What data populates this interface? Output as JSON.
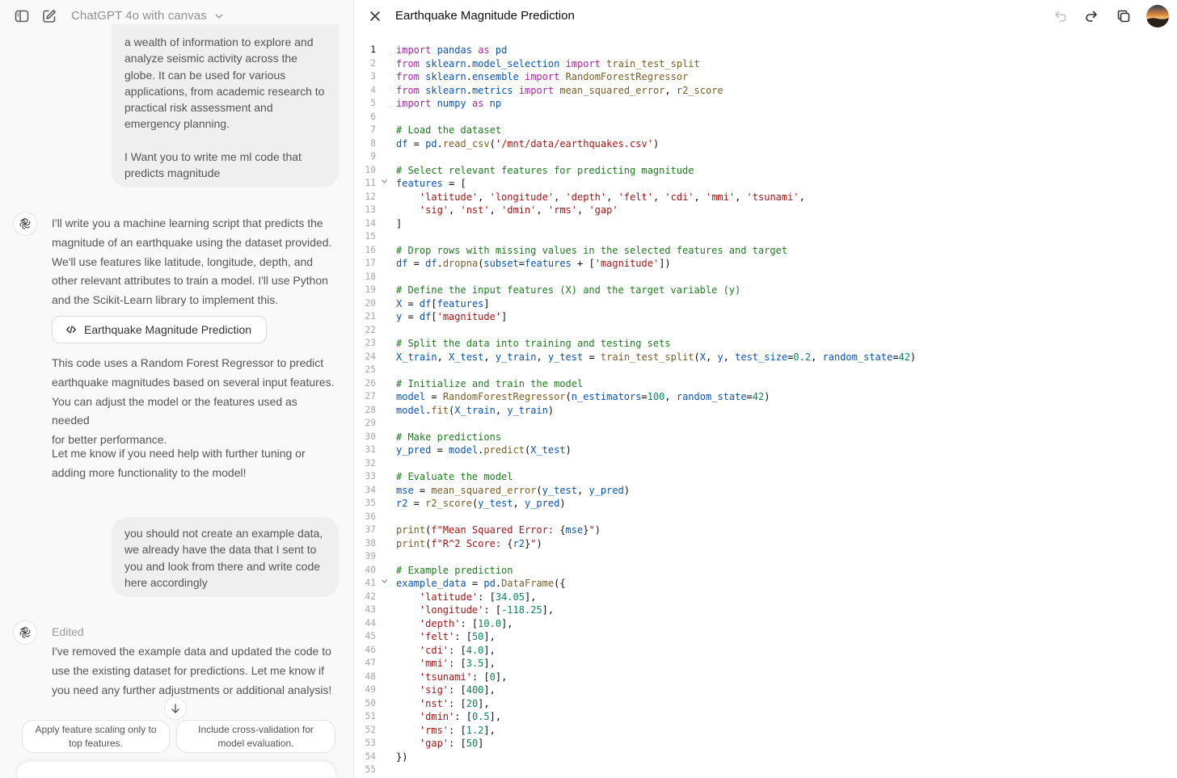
{
  "chat": {
    "model_name": "ChatGPT 4o with canvas",
    "user_message_1": {
      "lines": [
        "a wealth of information to explore and",
        "analyze seismic activity across the",
        "globe. It can be used for various",
        "applications, from academic research to",
        "practical risk assessment and",
        "emergency planning.",
        "",
        "I Want you to write me ml code that",
        "predicts magnitude"
      ]
    },
    "assistant_message_1": {
      "intro_lines": [
        "I'll write you a machine learning script that predicts the",
        "magnitude of an earthquake using the dataset provided.",
        "We'll use features like latitude, longitude, depth, and",
        "other relevant attributes to train a model. I'll use Python",
        "and the Scikit-Learn library to implement this."
      ],
      "canvas_chip_label": "Earthquake Magnitude Prediction",
      "body_lines": [
        "This code uses a Random Forest Regressor to predict",
        "earthquake magnitudes based on several input features.",
        "You can adjust the model or the features used as needed",
        "for better performance."
      ],
      "closing_lines": [
        "Let me know if you need help with further tuning or",
        "adding more functionality to the model!"
      ]
    },
    "user_message_2": {
      "lines": [
        "you should not create an example data,",
        "we already have the data that I sent to",
        "you and look from there and write code",
        "here accordingly"
      ]
    },
    "assistant_message_2": {
      "status": "Edited",
      "lines": [
        "I've removed the example data and updated the code to",
        "use the existing dataset for predictions. Let me know if",
        "you need any further adjustments or additional analysis!"
      ]
    },
    "suggestions": [
      {
        "line1": "Apply feature scaling only to",
        "line2": "top features."
      },
      {
        "line1": "Include cross-validation for",
        "line2": "model evaluation."
      }
    ]
  },
  "canvas": {
    "title": "Earthquake Magnitude Prediction",
    "active_line": 1,
    "fold_lines": [
      11,
      41
    ],
    "code_lines": [
      "import pandas as pd",
      "from sklearn.model_selection import train_test_split",
      "from sklearn.ensemble import RandomForestRegressor",
      "from sklearn.metrics import mean_squared_error, r2_score",
      "import numpy as np",
      "",
      "# Load the dataset",
      "df = pd.read_csv('/mnt/data/earthquakes.csv')",
      "",
      "# Select relevant features for predicting magnitude",
      "features = [",
      "    'latitude', 'longitude', 'depth', 'felt', 'cdi', 'mmi', 'tsunami',",
      "    'sig', 'nst', 'dmin', 'rms', 'gap'",
      "]",
      "",
      "# Drop rows with missing values in the selected features and target",
      "df = df.dropna(subset=features + ['magnitude'])",
      "",
      "# Define the input features (X) and the target variable (y)",
      "X = df[features]",
      "y = df['magnitude']",
      "",
      "# Split the data into training and testing sets",
      "X_train, X_test, y_train, y_test = train_test_split(X, y, test_size=0.2, random_state=42)",
      "",
      "# Initialize and train the model",
      "model = RandomForestRegressor(n_estimators=100, random_state=42)",
      "model.fit(X_train, y_train)",
      "",
      "# Make predictions",
      "y_pred = model.predict(X_test)",
      "",
      "# Evaluate the model",
      "mse = mean_squared_error(y_test, y_pred)",
      "r2 = r2_score(y_test, y_pred)",
      "",
      "print(f\"Mean Squared Error: {mse}\")",
      "print(f\"R^2 Score: {r2}\")",
      "",
      "# Example prediction",
      "example_data = pd.DataFrame({",
      "    'latitude': [34.05],",
      "    'longitude': [-118.25],",
      "    'depth': [10.0],",
      "    'felt': [50],",
      "    'cdi': [4.0],",
      "    'mmi': [3.5],",
      "    'tsunami': [0],",
      "    'sig': [400],",
      "    'nst': [20],",
      "    'dmin': [0.5],",
      "    'rms': [1.2],",
      "    'gap': [50]",
      "})",
      ""
    ]
  },
  "icons": {
    "sidebar_toggle": "sidebar-icon",
    "new_chat": "compose-icon",
    "model_menu": "chevron-down-icon",
    "assistant": "openai-logo-icon",
    "canvas_chip": "code-icon",
    "scroll": "arrow-down-icon",
    "close": "close-icon",
    "undo": "undo-icon",
    "redo": "redo-icon",
    "copy": "copy-icon",
    "user": "avatar"
  }
}
